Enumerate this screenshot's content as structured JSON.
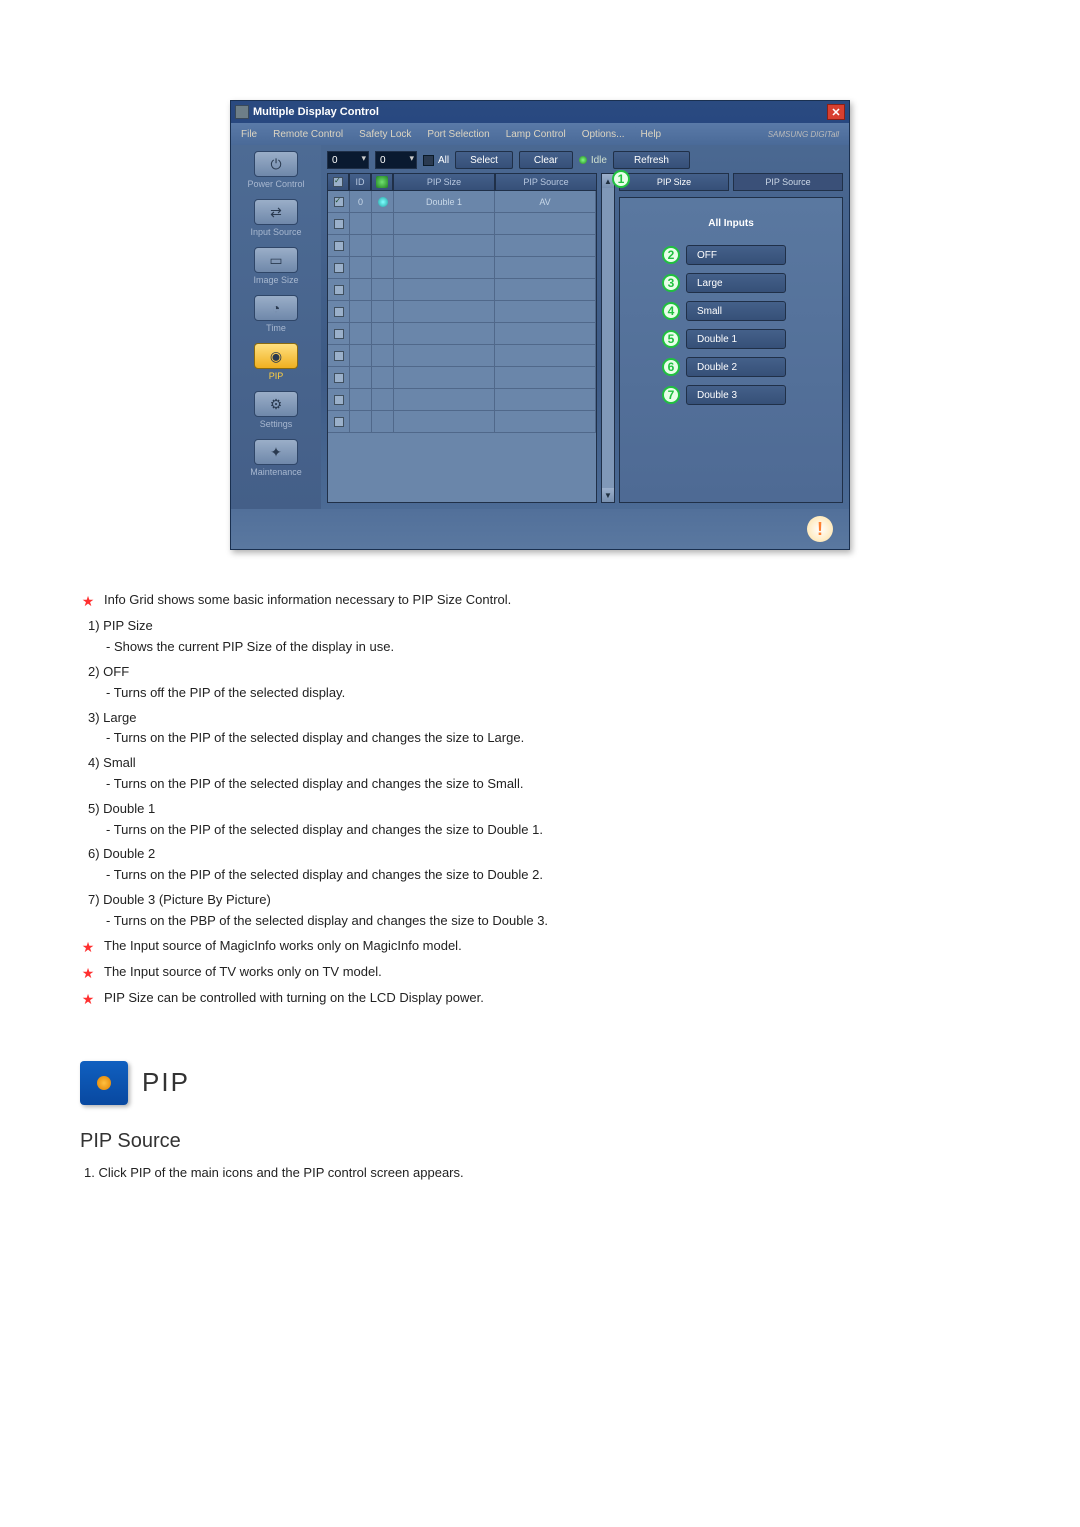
{
  "window": {
    "title": "Multiple Display Control",
    "brand": "SAMSUNG DIGITall"
  },
  "menu": {
    "file": "File",
    "remote": "Remote Control",
    "safety": "Safety Lock",
    "port": "Port Selection",
    "lamp": "Lamp Control",
    "options": "Options...",
    "help": "Help"
  },
  "sidebar": {
    "power": "Power Control",
    "input": "Input Source",
    "image": "Image Size",
    "time": "Time",
    "pip": "PIP",
    "settings": "Settings",
    "maint": "Maintenance"
  },
  "toolbar": {
    "spin1": "0",
    "spin2": "0",
    "all": "All",
    "select": "Select",
    "clear": "Clear",
    "idle": "Idle",
    "refresh": "Refresh"
  },
  "grid": {
    "h_id": "ID",
    "h_size": "PIP Size",
    "h_source": "PIP Source",
    "row0_id": "0",
    "row0_size": "Double 1",
    "row0_source": "AV"
  },
  "panel": {
    "tab_size": "PIP Size",
    "tab_source": "PIP Source",
    "all_inputs": "All Inputs",
    "off": "OFF",
    "large": "Large",
    "small": "Small",
    "d1": "Double 1",
    "d2": "Double 2",
    "d3": "Double 3"
  },
  "callouts": {
    "n1": "1",
    "n2": "2",
    "n3": "3",
    "n4": "4",
    "n5": "5",
    "n6": "6",
    "n7": "7"
  },
  "doc": {
    "intro": "Info Grid shows some basic information necessary to PIP Size Control.",
    "i1_t": "1)  PIP Size",
    "i1_d": "- Shows the current PIP Size of the display in use.",
    "i2_t": "2)  OFF",
    "i2_d": "- Turns off the PIP of the selected display.",
    "i3_t": "3)  Large",
    "i3_d": "- Turns on the PIP of the selected display and changes the size to Large.",
    "i4_t": "4)  Small",
    "i4_d": "- Turns on the PIP of the selected display and changes the size to Small.",
    "i5_t": "5)  Double 1",
    "i5_d": "- Turns on the PIP of the selected display and changes the size to Double 1.",
    "i6_t": "6)  Double 2",
    "i6_d": "- Turns on the PIP of the selected display and changes the size to Double 2.",
    "i7_t": "7)  Double 3 (Picture By Picture)",
    "i7_d": "- Turns on the PBP of the selected display and changes the size to Double 3.",
    "note1": "The Input source of MagicInfo works only on MagicInfo model.",
    "note2": "The Input source of TV works only on TV model.",
    "note3": "PIP Size can be controlled with turning on the LCD Display power.",
    "sec_title": "PIP",
    "subheading": "PIP Source",
    "step1": "1.  Click PIP of the main icons and the PIP control screen appears."
  }
}
